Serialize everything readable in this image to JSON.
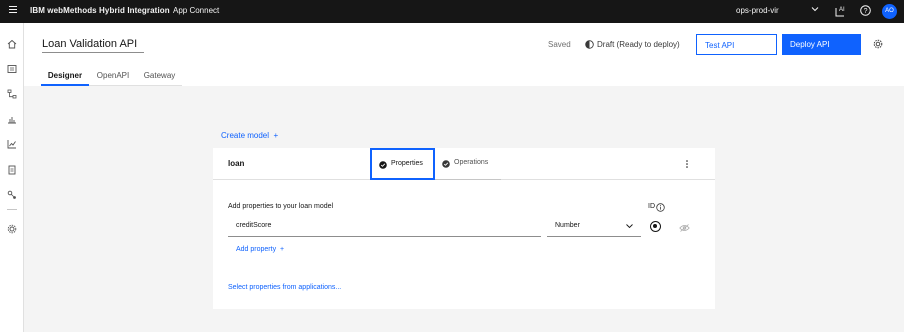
{
  "topbar": {
    "brand": "IBM webMethods Hybrid Integration",
    "app": "App Connect",
    "environment": "ops-prod-vir",
    "avatar_initials": "AO",
    "icons": [
      "menu-icon",
      "chevron-down-icon",
      "ai-icon",
      "help-icon"
    ]
  },
  "rail": {
    "icons": [
      "home-icon",
      "catalog-icon",
      "flow-icon",
      "deploy-icon",
      "chart-icon",
      "document-icon",
      "connections-icon",
      "settings-icon"
    ]
  },
  "header": {
    "title": "Loan Validation API",
    "saved": "Saved",
    "status": "Draft (Ready to deploy)",
    "test_label": "Test API",
    "deploy_label": "Deploy API"
  },
  "tabs": [
    {
      "label": "Designer",
      "active": true
    },
    {
      "label": "OpenAPI",
      "active": false
    },
    {
      "label": "Gateway",
      "active": false
    }
  ],
  "canvas": {
    "create_model": "Create model",
    "create_model_plus": "+"
  },
  "model": {
    "name": "loan",
    "tabs": {
      "properties": "Properties",
      "operations": "Operations"
    },
    "add_text": "Add properties to your loan model",
    "id_label": "ID",
    "property_value": "creditScore",
    "type_value": "Number",
    "add_property": "Add property",
    "add_property_plus": "+",
    "select_apps": "Select properties from applications..."
  },
  "colors": {
    "accent": "#0f62fe",
    "topbar": "#161616",
    "canvas": "#f4f4f4"
  }
}
